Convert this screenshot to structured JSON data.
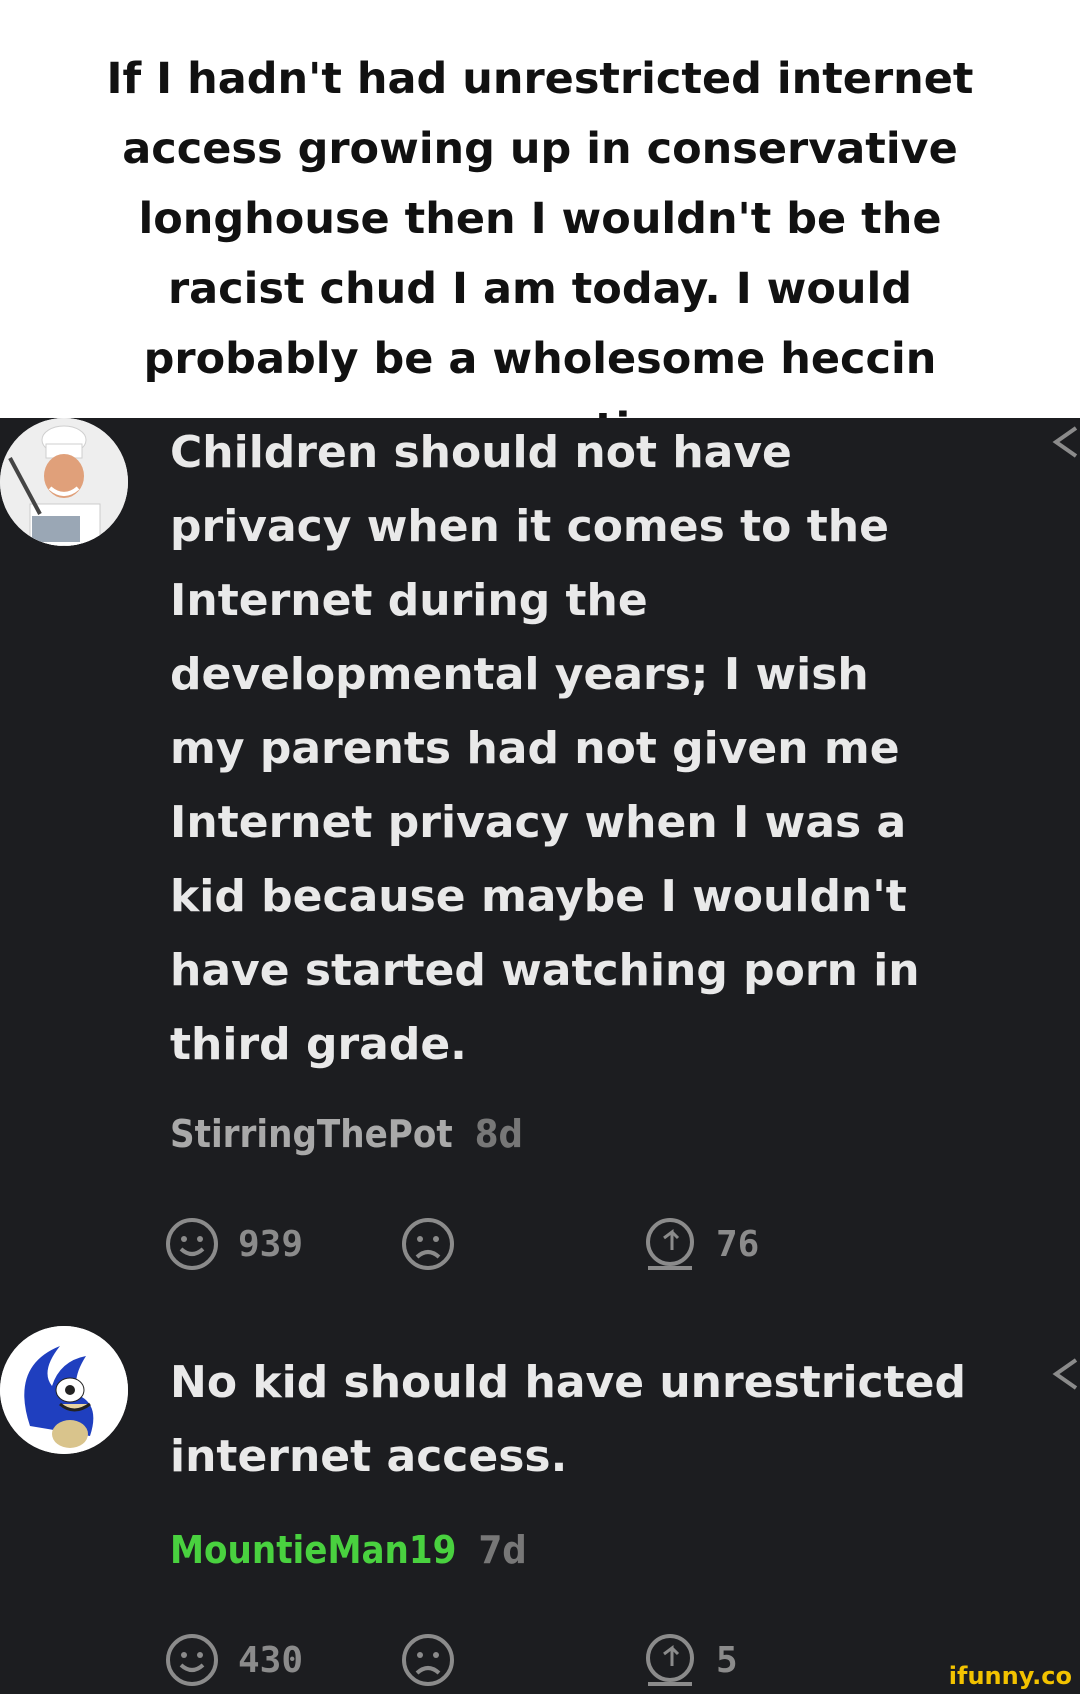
{
  "caption": {
    "text": "If I hadn't had unrestricted internet access growing up in conservative longhouse then I wouldn't be the racist chud I am today. I would probably be a wholesome heccin conservative."
  },
  "comments": [
    {
      "avatar_icon": "chef-avatar-icon",
      "text": "Children should not have privacy when it comes to the Internet during the developmental years; I wish my parents had not given me Internet privacy when I was a kid because maybe I wouldn't have started watching porn in third grade.",
      "username": "StirringThePot",
      "username_color": "#a9a9a9",
      "time": "8d",
      "smiles": "939",
      "replies": "76"
    },
    {
      "avatar_icon": "sonic-avatar-icon",
      "text": "No kid should have unrestricted internet access.",
      "username": "MountieMan19",
      "username_color": "#49d13f",
      "time": "7d",
      "smiles": "430",
      "replies": "5"
    }
  ],
  "watermark": "ifunny.co"
}
